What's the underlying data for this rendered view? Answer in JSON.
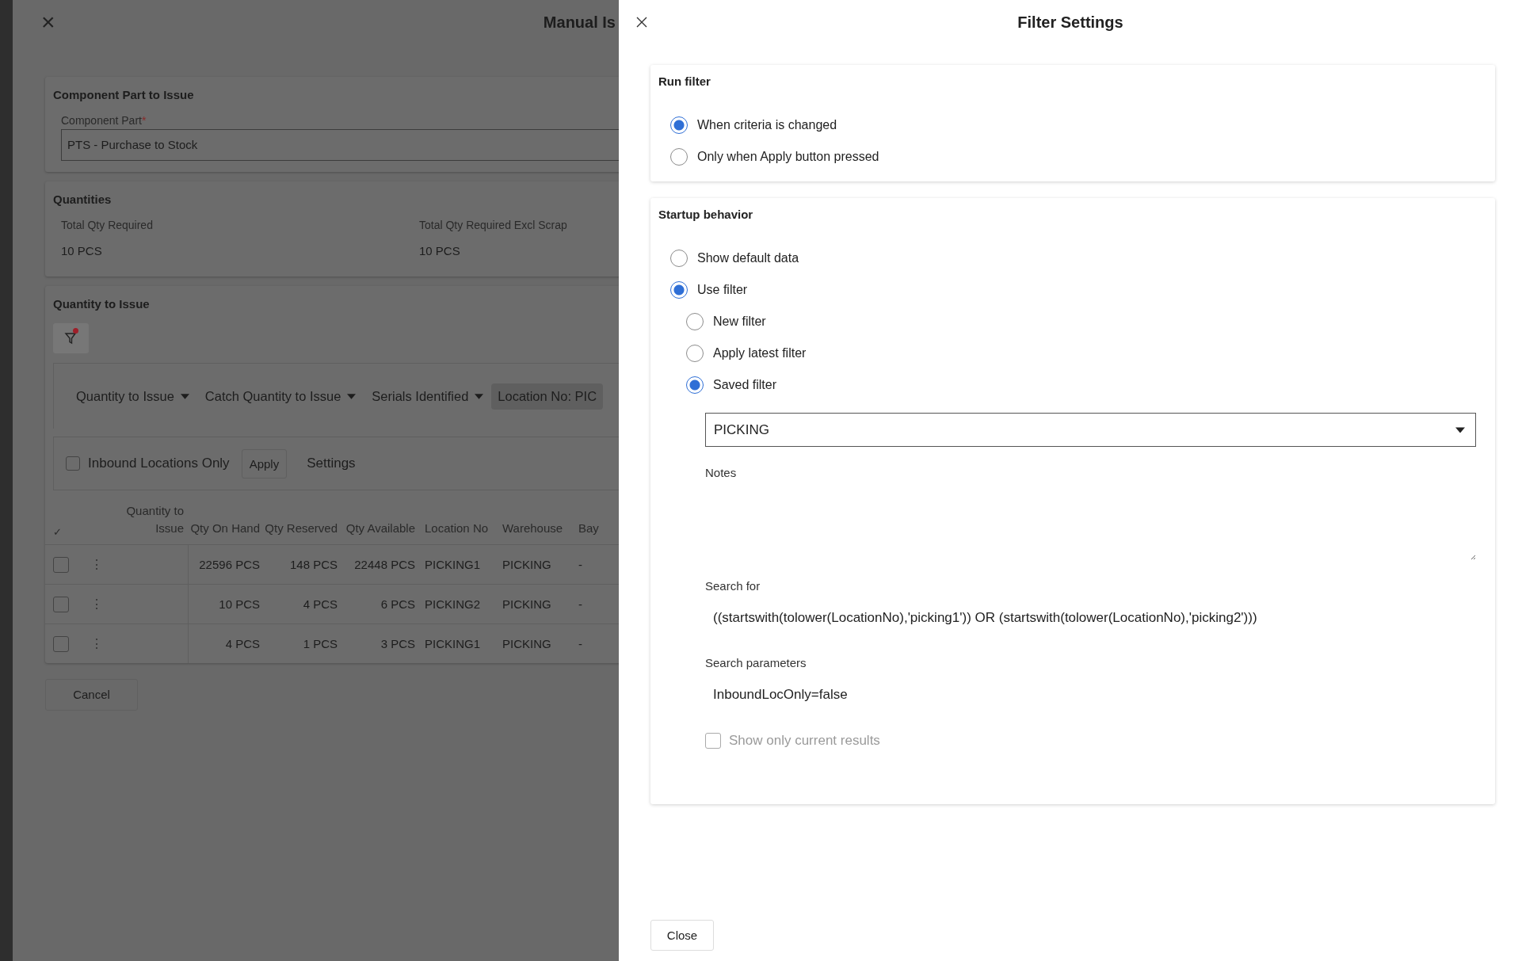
{
  "background_page": {
    "close": "×",
    "title": "Manual Is",
    "component_section": {
      "title": "Component Part to Issue",
      "field_label": "Component Part",
      "required_mark": "*",
      "value": "PTS - Purchase to Stock"
    },
    "quantities_section": {
      "title": "Quantities",
      "fields": [
        {
          "label": "Total Qty Required",
          "value": "10 PCS"
        },
        {
          "label": "Total Qty Required Excl Scrap",
          "value": "10 PCS"
        }
      ]
    },
    "issue_section": {
      "title": "Quantity to Issue",
      "filter_active": true,
      "filter_chips": [
        {
          "kind": "dropdown",
          "label": "Quantity to Issue"
        },
        {
          "kind": "dropdown",
          "label": "Catch Quantity to Issue"
        },
        {
          "kind": "dropdown",
          "label": "Serials Identified"
        },
        {
          "kind": "chip",
          "label": "Location No: PIC"
        }
      ],
      "inbound_only": {
        "label": "Inbound Locations Only",
        "checked": false
      },
      "apply_button": "Apply",
      "settings_link": "Settings",
      "table": {
        "select_all": "✓",
        "columns": [
          "Quantity to Issue",
          "Qty On Hand",
          "Qty Reserved",
          "Qty Available",
          "Location No",
          "Warehouse",
          "Bay"
        ],
        "rows": [
          {
            "checked": false,
            "menu": "⋮",
            "cells": [
              "",
              "22596 PCS",
              "148 PCS",
              "22448 PCS",
              "PICKING1",
              "PICKING",
              "-"
            ]
          },
          {
            "checked": false,
            "menu": "⋮",
            "cells": [
              "",
              "10 PCS",
              "4 PCS",
              "6 PCS",
              "PICKING2",
              "PICKING",
              "-"
            ]
          },
          {
            "checked": false,
            "menu": "⋮",
            "cells": [
              "",
              "4 PCS",
              "1 PCS",
              "3 PCS",
              "PICKING1",
              "PICKING",
              "-"
            ]
          }
        ]
      }
    },
    "cancel_button": "Cancel"
  },
  "dialog": {
    "title": "Filter Settings",
    "run_filter": {
      "title": "Run filter",
      "options": [
        {
          "label": "When criteria is changed",
          "selected": true
        },
        {
          "label": "Only when Apply button pressed",
          "selected": false
        }
      ]
    },
    "startup": {
      "title": "Startup behavior",
      "options": [
        {
          "label": "Show default data",
          "selected": false
        },
        {
          "label": "Use filter",
          "selected": true,
          "children": [
            {
              "label": "New filter",
              "selected": false
            },
            {
              "label": "Apply latest filter",
              "selected": false
            },
            {
              "label": "Saved filter",
              "selected": true
            }
          ]
        }
      ],
      "saved_filter": "PICKING",
      "notes": {
        "label": "Notes"
      },
      "search_for": {
        "label": "Search for",
        "value": "((startswith(tolower(LocationNo),'picking1')) OR (startswith(tolower(LocationNo),'picking2')))"
      },
      "search_parameters": {
        "label": "Search parameters",
        "value": "InboundLocOnly=false"
      },
      "current_results": {
        "label": "Show only current results",
        "checked": false,
        "disabled": true
      }
    },
    "close_button": "Close"
  }
}
